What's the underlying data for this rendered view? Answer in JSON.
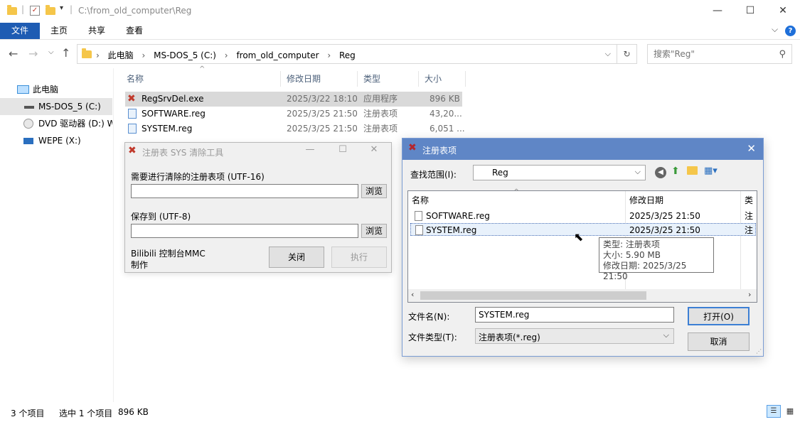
{
  "window": {
    "path": "C:\\from_old_computer\\Reg",
    "minimize": "—",
    "maximize": "☐",
    "close": "✕"
  },
  "ribbon": {
    "tabs": [
      "文件",
      "主页",
      "共享",
      "查看"
    ]
  },
  "address": {
    "crumbs": [
      "此电脑",
      "MS-DOS_5 (C:)",
      "from_old_computer",
      "Reg"
    ],
    "search_placeholder": "搜索\"Reg\""
  },
  "nav_pane": {
    "items": [
      {
        "label": "此电脑"
      },
      {
        "label": "MS-DOS_5 (C:)"
      },
      {
        "label": "DVD 驱动器 (D:) W"
      },
      {
        "label": "WEPE (X:)"
      }
    ]
  },
  "file_list": {
    "columns": [
      "名称",
      "修改日期",
      "类型",
      "大小"
    ],
    "rows": [
      {
        "name": "RegSrvDel.exe",
        "date": "2025/3/22 18:10",
        "type": "应用程序",
        "size": "896 KB"
      },
      {
        "name": "SOFTWARE.reg",
        "date": "2025/3/25 21:50",
        "type": "注册表项",
        "size": "43,20..."
      },
      {
        "name": "SYSTEM.reg",
        "date": "2025/3/25 21:50",
        "type": "注册表项",
        "size": "6,051 ..."
      }
    ]
  },
  "status": {
    "count": "3 个项目",
    "selected": "选中 1 个项目",
    "size": "896 KB"
  },
  "tool": {
    "title": "注册表 SYS 清除工具",
    "label1": "需要进行清除的注册表项 (UTF-16)",
    "input1": "",
    "browse1": "浏览",
    "label2": "保存到 (UTF-8)",
    "input2": "",
    "browse2": "浏览",
    "credit_line1": "Bilibili 控制台MMC",
    "credit_line2": "制作",
    "close_btn": "关闭",
    "run_btn": "执行"
  },
  "open_dialog": {
    "title": "注册表项",
    "lookin_label": "查找范围(I):",
    "lookin_value": "Reg",
    "columns": [
      "名称",
      "修改日期",
      "类"
    ],
    "rows": [
      {
        "name": "SOFTWARE.reg",
        "date": "2025/3/25 21:50",
        "type": "注"
      },
      {
        "name": "SYSTEM.reg",
        "date": "2025/3/25 21:50",
        "type": "注"
      }
    ],
    "tooltip": {
      "type": "类型: 注册表项",
      "size": "大小: 5.90 MB",
      "date": "修改日期: 2025/3/25 21:50"
    },
    "filename_label": "文件名(N):",
    "filename_value": "SYSTEM.reg",
    "filetype_label": "文件类型(T):",
    "filetype_value": "注册表项(*.reg)",
    "open_btn": "打开(O)",
    "cancel_btn": "取消"
  }
}
